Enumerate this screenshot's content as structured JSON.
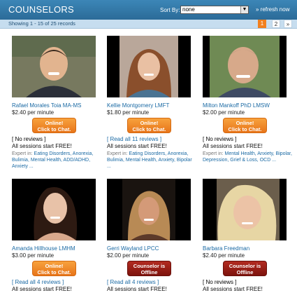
{
  "header": {
    "title": "COUNSELORS",
    "sort_label": "Sort By:",
    "sort_value": "none",
    "refresh_label": "» refresh now"
  },
  "subbar": {
    "showing": "Showing 1 - 15 of 25 records",
    "pages": [
      "1",
      "2",
      "»"
    ],
    "current_page": "1"
  },
  "counselors": [
    {
      "name": "Rafael Morales Toia MA-MS",
      "price": "$2.40 per minute",
      "status": "Online!\nClick to Chat.",
      "reviews": "[ No reviews ]",
      "free_note": "All sessions start FREE!",
      "expert_prefix": "Expert in:",
      "topics": "Eating Disorders, Anorexia, Bulimia, Mental Health, ADD/ADHD, Anxiety ..."
    },
    {
      "name": "Kellie Montgomery LMFT",
      "price": "$1.80 per minute",
      "status": "Online!\nClick to Chat.",
      "reviews": "[ Read all 11 reviews ]",
      "free_note": "All sessions start FREE!",
      "expert_prefix": "Expert in:",
      "topics": "Eating Disorders, Anorexia, Bulimia, Mental Health, Anxiety, Bipolar ..."
    },
    {
      "name": "Milton Mankoff PhD LMSW",
      "price": "$2.00 per minute",
      "status": "Online!\nClick to Chat.",
      "reviews": "[ No reviews ]",
      "free_note": "All sessions start FREE!",
      "expert_prefix": "Expert in:",
      "topics": "Mental Health, Anxiety, Bipolar, Depression, Grief & Loss, OCD ..."
    },
    {
      "name": "Amanda Hillhouse LMHM",
      "price": "$3.00 per minute",
      "status": "Online!\nClick to Chat.",
      "reviews": "[ Read all 4 reviews ]",
      "free_note": "All sessions start FREE!"
    },
    {
      "name": "Gerri Wayland LPCC",
      "price": "$2.00 per minute",
      "status": "Counselor is\nOffline",
      "reviews": "[ Read all 4 reviews ]",
      "free_note": "All sessions start FREE!"
    },
    {
      "name": "Barbara Freedman",
      "price": "$2.40 per minute",
      "status": "Counselor is\nOffline",
      "reviews": "[ No reviews ]",
      "free_note": "All sessions start FREE!"
    }
  ],
  "colors": {
    "header_blue": "#2f75a5",
    "online_orange": "#f0861f",
    "offline_red": "#9a1f16",
    "link_blue": "#1b6aa4"
  }
}
